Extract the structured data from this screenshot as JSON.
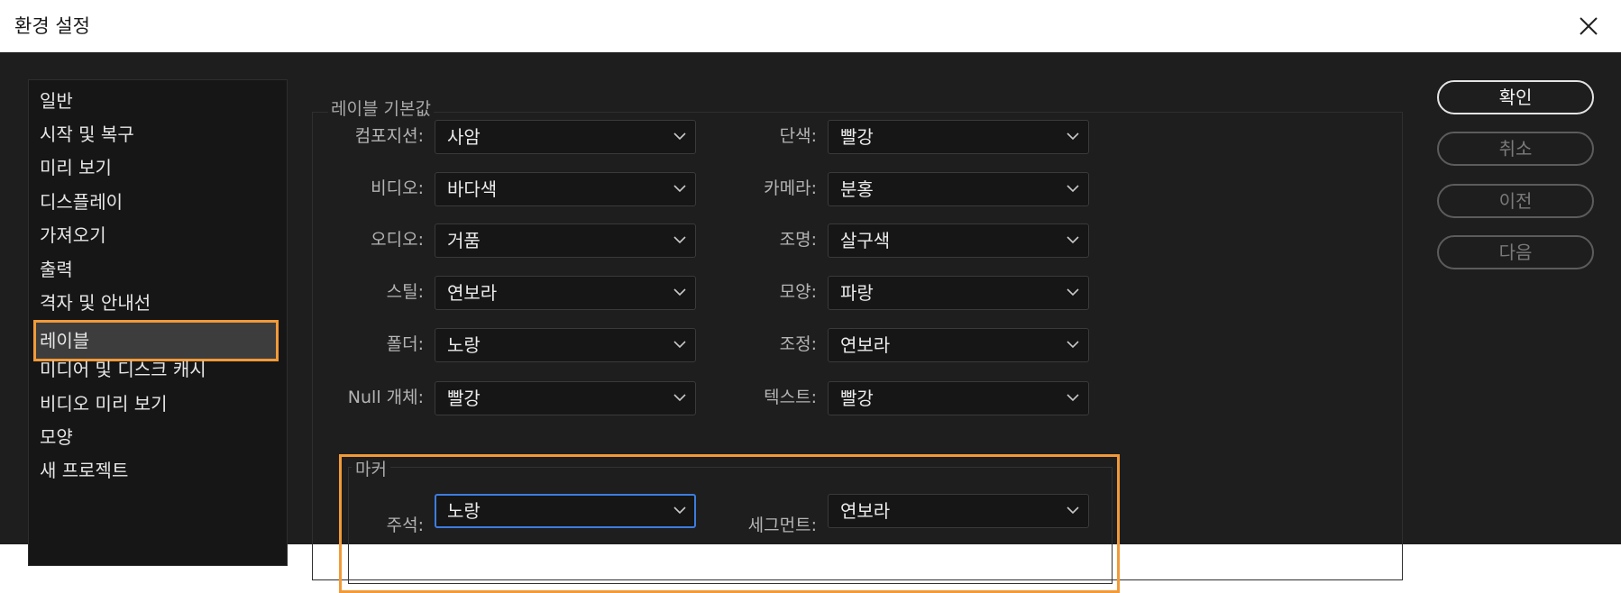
{
  "window": {
    "title": "환경 설정"
  },
  "sidebar": {
    "items": [
      {
        "label": "일반"
      },
      {
        "label": "시작 및 복구"
      },
      {
        "label": "미리 보기"
      },
      {
        "label": "디스플레이"
      },
      {
        "label": "가져오기"
      },
      {
        "label": "출력"
      },
      {
        "label": "격자 및 안내선"
      },
      {
        "label": "레이블",
        "selected": true
      },
      {
        "label": "미디어 및 디스크 캐시"
      },
      {
        "label": "비디오 미리 보기"
      },
      {
        "label": "모양"
      },
      {
        "label": "새 프로젝트"
      }
    ]
  },
  "label_defaults": {
    "group_title": "레이블 기본값",
    "left": [
      {
        "label": "컴포지션:",
        "value": "사암"
      },
      {
        "label": "비디오:",
        "value": "바다색"
      },
      {
        "label": "오디오:",
        "value": "거품"
      },
      {
        "label": "스틸:",
        "value": "연보라"
      },
      {
        "label": "폴더:",
        "value": "노랑"
      },
      {
        "label": "Null 개체:",
        "value": "빨강"
      }
    ],
    "right": [
      {
        "label": "단색:",
        "value": "빨강"
      },
      {
        "label": "카메라:",
        "value": "분홍"
      },
      {
        "label": "조명:",
        "value": "살구색"
      },
      {
        "label": "모양:",
        "value": "파랑"
      },
      {
        "label": "조정:",
        "value": "연보라"
      },
      {
        "label": "텍스트:",
        "value": "빨강"
      }
    ]
  },
  "markers": {
    "group_title": "마커",
    "comment": {
      "label": "주석:",
      "value": "노랑"
    },
    "segment": {
      "label": "세그먼트:",
      "value": "연보라"
    }
  },
  "buttons": {
    "ok": "확인",
    "cancel": "취소",
    "previous": "이전",
    "next": "다음"
  },
  "colors": {
    "highlight": "#f29a38",
    "focus": "#3d7ce0",
    "dialog_bg": "#1e1e1e"
  }
}
